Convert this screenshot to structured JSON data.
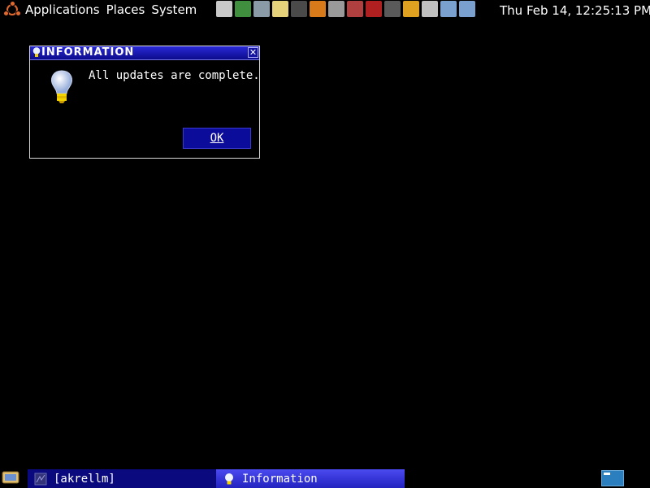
{
  "top_panel": {
    "menus": [
      "Applications",
      "Places",
      "System"
    ],
    "clock": "Thu Feb 14, 12:25:13 PM",
    "tray_icons": [
      {
        "name": "screenshot-icon",
        "color": "#c9c9c9"
      },
      {
        "name": "web-browser-icon",
        "color": "#3f8f3f"
      },
      {
        "name": "chat-icon",
        "color": "#8a9aa6"
      },
      {
        "name": "text-editor-icon",
        "color": "#e6d27a"
      },
      {
        "name": "terminal-icon",
        "color": "#4a4a4a"
      },
      {
        "name": "audio-player-icon",
        "color": "#d87a1a"
      },
      {
        "name": "media-device-icon",
        "color": "#9a9a9a"
      },
      {
        "name": "package-icon",
        "color": "#b04040"
      },
      {
        "name": "help-book-icon",
        "color": "#b02020"
      },
      {
        "name": "headphones-icon",
        "color": "#5a5a5a"
      },
      {
        "name": "cancel-icon",
        "color": "#e0a020"
      },
      {
        "name": "keyboard-icon",
        "color": "#c0c0c0"
      },
      {
        "name": "network-monitor-icon",
        "color": "#7aa0d0"
      },
      {
        "name": "network-connections-icon",
        "color": "#7aa0d0"
      }
    ]
  },
  "dialog": {
    "title": "INFORMATION",
    "close_glyph": "✕",
    "message": "All updates are complete.",
    "ok_label": "OK"
  },
  "bottom_panel": {
    "tasks": [
      {
        "label": "[akrellm]",
        "active": false
      },
      {
        "label": "Information",
        "active": true
      }
    ]
  },
  "colors": {
    "titlebar": "#0b0b8c",
    "button": "#0c0c9a",
    "active_task": "#2323c0",
    "inactive_task": "#0a0a7e",
    "workspace": "#2c7fbf"
  }
}
